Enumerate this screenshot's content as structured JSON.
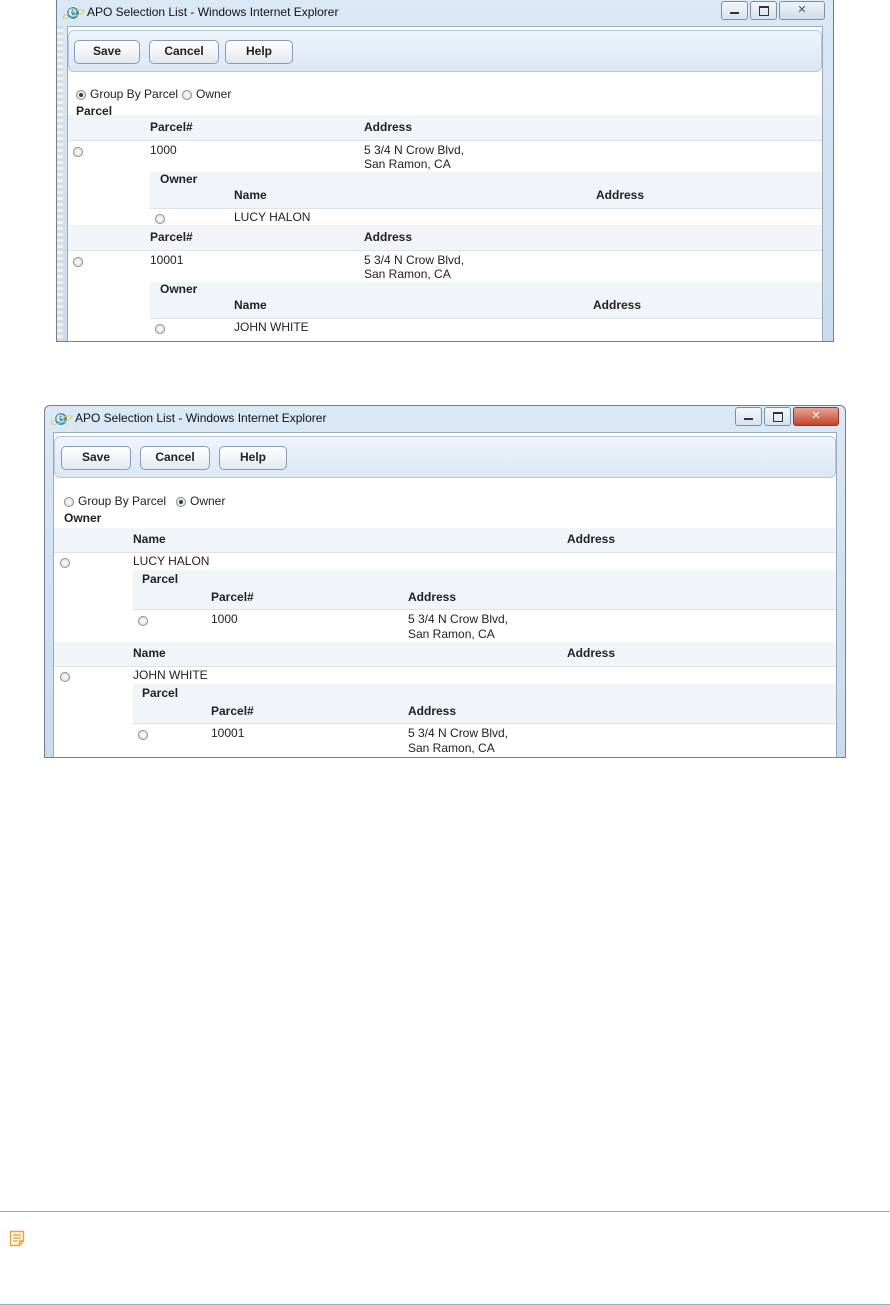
{
  "window1": {
    "title": "APO Selection List - Windows Internet Explorer",
    "buttons": {
      "save": "Save",
      "cancel": "Cancel",
      "help": "Help"
    },
    "options": {
      "group_by_parcel": "Group By Parcel",
      "owner": "Owner"
    },
    "selected_option": "group_by_parcel",
    "section_label": "Parcel",
    "columns": {
      "parcel": "Parcel#",
      "address": "Address"
    },
    "sub_section_label": "Owner",
    "sub_columns": {
      "name": "Name",
      "address": "Address"
    },
    "groups": [
      {
        "parcel": "1000",
        "address_line1": "5 3/4 N Crow Blvd,",
        "address_line2": "San Ramon, CA",
        "owner_name": "LUCY HALON"
      },
      {
        "parcel": "10001",
        "address_line1": "5 3/4 N Crow Blvd,",
        "address_line2": "San Ramon, CA",
        "owner_name": "JOHN WHITE"
      }
    ]
  },
  "window2": {
    "title": "APO Selection List - Windows Internet Explorer",
    "buttons": {
      "save": "Save",
      "cancel": "Cancel",
      "help": "Help"
    },
    "options": {
      "group_by_parcel": "Group By Parcel",
      "owner": "Owner"
    },
    "selected_option": "owner",
    "section_label": "Owner",
    "columns": {
      "name": "Name",
      "address": "Address"
    },
    "sub_section_label": "Parcel",
    "sub_columns": {
      "parcel": "Parcel#",
      "address": "Address"
    },
    "groups": [
      {
        "owner_name": "LUCY HALON",
        "parcel": "1000",
        "address_line1": "5 3/4 N Crow Blvd,",
        "address_line2": "San Ramon, CA"
      },
      {
        "owner_name": "JOHN WHITE",
        "parcel": "10001",
        "address_line1": "5 3/4 N Crow Blvd,",
        "address_line2": "San Ramon, CA"
      }
    ]
  },
  "colors": {
    "close_button": "#c4432b",
    "toolbar_bg": "#dbe7f4",
    "note_border": "#86b9cb",
    "note_icon": "#e8a33a"
  },
  "icons": [
    "ie-icon",
    "minimize-icon",
    "maximize-icon",
    "close-icon",
    "note-icon"
  ]
}
